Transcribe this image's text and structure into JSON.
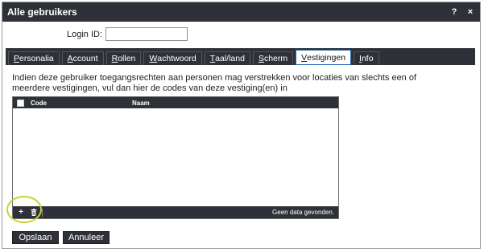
{
  "window": {
    "title": "Alle gebruikers",
    "help_label": "?",
    "close_label": "×"
  },
  "login": {
    "label": "Login ID:",
    "value": ""
  },
  "tabs": [
    {
      "label": "Personalia",
      "underline": "P",
      "rest": "ersonalia",
      "active": false
    },
    {
      "label": "Account",
      "underline": "A",
      "rest": "ccount",
      "active": false
    },
    {
      "label": "Rollen",
      "underline": "R",
      "rest": "ollen",
      "active": false
    },
    {
      "label": "Wachtwoord",
      "underline": "W",
      "rest": "achtwoord",
      "active": false
    },
    {
      "label": "Taal/land",
      "underline": "T",
      "rest": "aal/land",
      "active": false
    },
    {
      "label": "Scherm",
      "underline": "S",
      "rest": "cherm",
      "active": false
    },
    {
      "label": "Vestigingen",
      "underline": "V",
      "rest": "estigingen",
      "active": true
    },
    {
      "label": "Info",
      "underline": "I",
      "rest": "nfo",
      "active": false
    }
  ],
  "description": "Indien deze gebruiker toegangsrechten aan personen mag verstrekken voor locaties van slechts een of meerdere vestigingen, vul dan hier de codes van deze vestiging(en) in",
  "grid": {
    "columns": [
      "Code",
      "Naam"
    ],
    "rows": [],
    "empty_message": "Geen data gevonden.",
    "add_label": "+",
    "delete_icon": "trash-icon"
  },
  "buttons": {
    "save": "Opslaan",
    "cancel": "Annuleer"
  },
  "colors": {
    "header_bg": "#2e3238",
    "active_tab_border": "#2a6fb8",
    "highlight": "#c8d52a"
  }
}
